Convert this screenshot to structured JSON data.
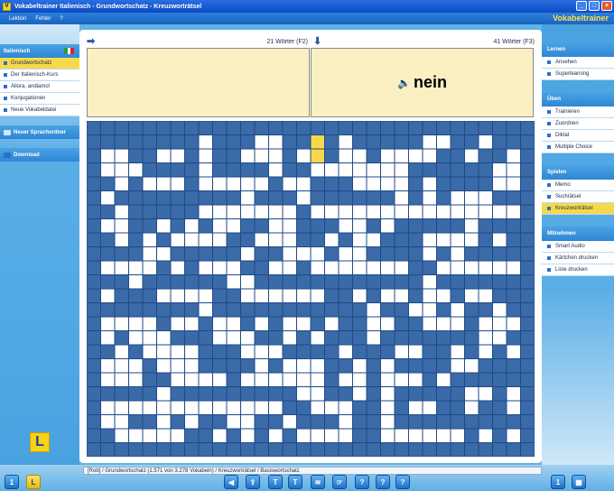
{
  "window": {
    "title": "Vokabeltrainer Italienisch - Grundwortschatz - Kreuzworträtsel",
    "brand": "Vokabeltrainer"
  },
  "menu": [
    "Lektion",
    "Fehler",
    "?"
  ],
  "left": {
    "section_title": "Italienisch",
    "items": [
      "Grundwortschatz",
      "Der Italienisch-Kurs",
      "Allora, andiamo!",
      "Konjugationen",
      "Neue Vokabeldatei"
    ],
    "active_index": 0,
    "new_folder": "Neuer Sprachordner",
    "download": "Download",
    "logo": "L"
  },
  "right": {
    "sections": [
      {
        "title": "Lernen",
        "items": [
          "Ansehen",
          "Superlearning"
        ]
      },
      {
        "title": "Üben",
        "items": [
          "Trainieren",
          "Zuordnen",
          "Diktat",
          "Multiple Choice"
        ]
      },
      {
        "title": "Spielen",
        "items": [
          "Memo",
          "Suchrätsel",
          "Kreuzworträtsel"
        ]
      },
      {
        "title": "Mitnehmen",
        "items": [
          "Smart Audio",
          "Kärtchen drucken",
          "Liste drucken"
        ]
      }
    ],
    "active": "Kreuzworträtsel"
  },
  "main": {
    "across_label": "21 Wörter (F2)",
    "down_label": "41 Wörter (F3)",
    "across_clue": "",
    "down_clue": "nein",
    "grid_cols": 32,
    "grid_rows": 24,
    "highlight_cells": [
      [
        16,
        1
      ],
      [
        16,
        2
      ]
    ],
    "colors": {
      "blue": "#3a6aa8",
      "blue_dark": "#1f4a88",
      "white": "#ffffff",
      "highlight": "#f6d94a"
    }
  },
  "status": {
    "text": "[Rob]   / Grundwortschatz  (1.571 von 3.278 Vokabeln) / Kreuzworträtsel / Basiswortschatz"
  },
  "toolbar": [
    "1",
    "L",
    "◀",
    "⇪",
    "T",
    "T",
    "≋",
    "☞",
    "?",
    "?",
    "?",
    "1",
    "▦"
  ]
}
